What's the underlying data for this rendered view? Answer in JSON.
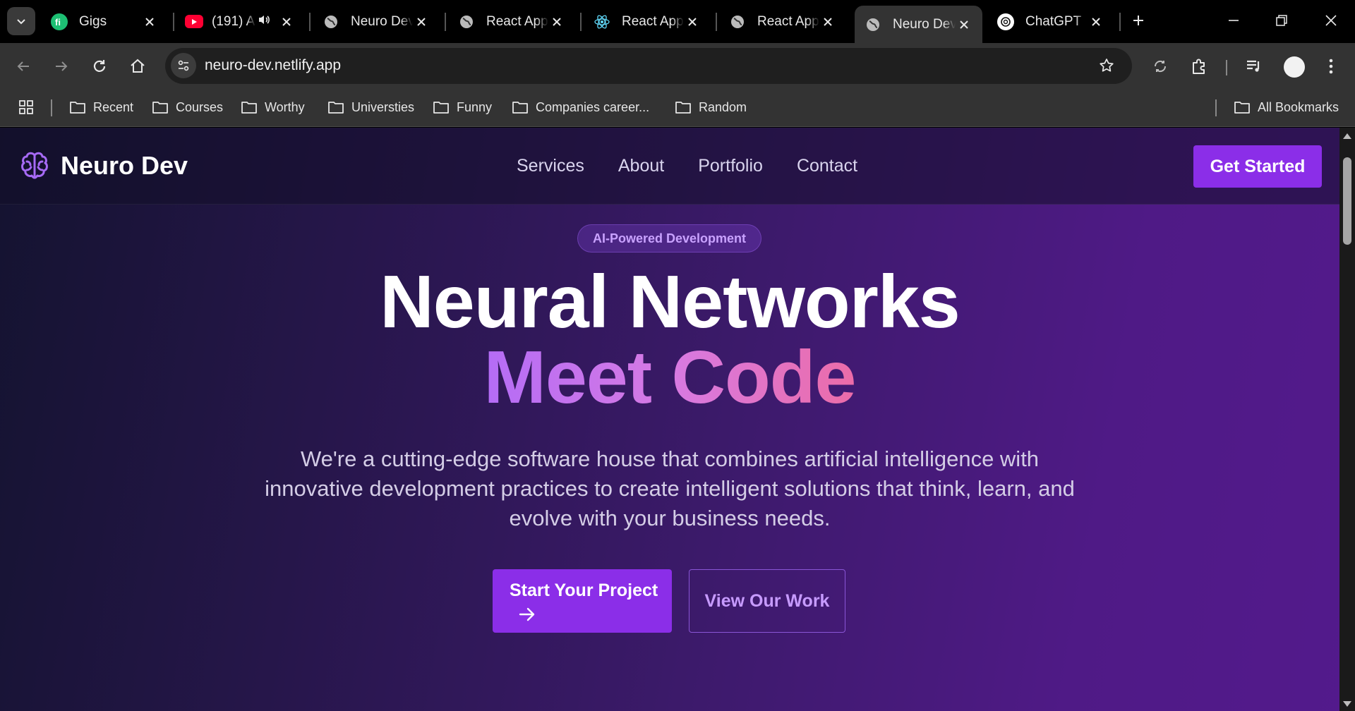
{
  "browser": {
    "tabs": [
      {
        "title": "Gigs",
        "icon": "fiverr-icon",
        "active": false
      },
      {
        "title": "(191) A",
        "icon": "youtube-icon",
        "audio": true,
        "active": false
      },
      {
        "title": "Neuro Dev",
        "icon": "globe-icon",
        "active": false
      },
      {
        "title": "React App",
        "icon": "globe-icon",
        "active": false
      },
      {
        "title": "React App",
        "icon": "react-icon",
        "active": false
      },
      {
        "title": "React App",
        "icon": "globe-icon",
        "active": false
      },
      {
        "title": "Neuro Dev",
        "icon": "globe-icon",
        "active": true
      },
      {
        "title": "ChatGPT",
        "icon": "chatgpt-icon",
        "active": false
      }
    ],
    "address": "neuro-dev.netlify.app",
    "bookmarks": [
      "Recent",
      "Courses",
      "Worthy",
      "Universties",
      "Funny",
      "Companies career...",
      "Random"
    ],
    "all_bookmarks": "All Bookmarks"
  },
  "site": {
    "brand": "Neuro Dev",
    "nav": [
      "Services",
      "About",
      "Portfolio",
      "Contact"
    ],
    "cta": "Get Started",
    "badge": "AI-Powered Development",
    "headline_1": "Neural Networks",
    "headline_2": "Meet Code",
    "subtitle": "We're a cutting-edge software house that combines artificial intelligence with innovative development practices to create intelligent solutions that think, learn, and evolve with your business needs.",
    "primary_button": "Start Your Project",
    "secondary_button": "View Our Work",
    "colors": {
      "accent": "#8b2ee8",
      "badge_text": "#c9a2ff",
      "gradient_start": "#b46cf6",
      "gradient_end": "#ec6ca8"
    }
  }
}
